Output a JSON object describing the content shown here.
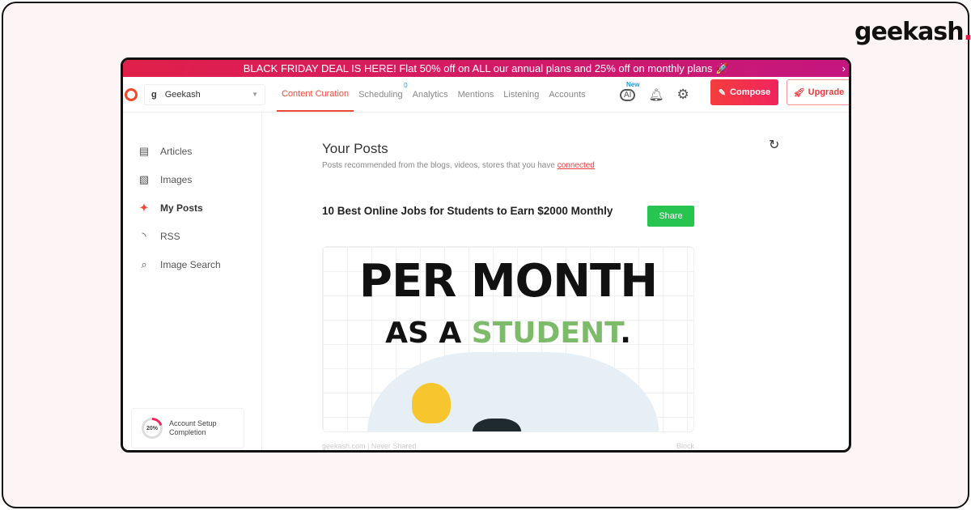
{
  "brand": {
    "logo_text": "geekash",
    "logo_dot": "."
  },
  "banner": {
    "text": "BLACK FRIDAY DEAL IS HERE! Flat 50% off on ALL our annual plans and 25% off on monthly plans 🚀",
    "close": "›"
  },
  "topbar": {
    "workspace": "Geekash",
    "workspace_icon": "g",
    "nav": [
      {
        "label": "Content Curation",
        "active": true
      },
      {
        "label": "Scheduling",
        "badge": "0"
      },
      {
        "label": "Analytics"
      },
      {
        "label": "Mentions"
      },
      {
        "label": "Listening"
      },
      {
        "label": "Accounts"
      }
    ],
    "ai_label": "AI",
    "ai_badge": "New",
    "compose": "Compose",
    "upgrade": "Upgrade"
  },
  "sidebar": {
    "items": [
      {
        "label": "Articles",
        "icon": "articles-icon"
      },
      {
        "label": "Images",
        "icon": "image-icon"
      },
      {
        "label": "My Posts",
        "icon": "sparkle-icon",
        "active": true
      },
      {
        "label": "RSS",
        "icon": "rss-icon"
      },
      {
        "label": "Image Search",
        "icon": "image-search-icon"
      }
    ],
    "setup": {
      "percent": "20%",
      "label": "Account Setup Completion",
      "progress": 20
    }
  },
  "main": {
    "title": "Your Posts",
    "subtitle": "Posts recommended from the blogs, videos, stores that you have ",
    "subtitle_link": "connected",
    "post": {
      "title": "10 Best Online Jobs for Students to Earn $2000 Monthly",
      "share": "Share",
      "image_line1": "PER MONTH",
      "image_line2a": "AS A ",
      "image_line2b": "STUDENT",
      "image_line2c": ".",
      "source": "geekash.com | Never Shared",
      "block": "Block"
    }
  },
  "colors": {
    "accent": "#ef4b3a",
    "share": "#27c44f",
    "link": "#1e9be9"
  }
}
